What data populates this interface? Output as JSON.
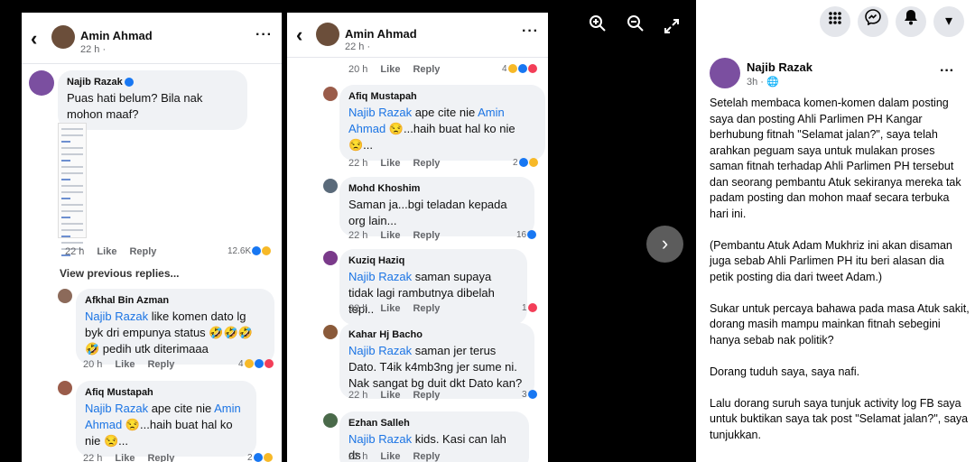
{
  "viewer": {
    "zoom_in_icon": "zoom-in-icon",
    "zoom_out_icon": "zoom-out-icon",
    "fullscreen_icon": "expand-icon",
    "next_icon": "chevron-right-icon"
  },
  "panel1": {
    "author": "Amin Ahmad",
    "time": "22 h ·",
    "main_comment": {
      "name": "Najib Razak",
      "text": "Puas hati belum? Bila nak mohon maaf?",
      "time": "22 h",
      "like": "Like",
      "reply": "Reply",
      "count": "12.6K"
    },
    "view_previous": "View previous replies...",
    "replies": [
      {
        "name": "Afkhal Bin Azman",
        "mention": "Najib Razak",
        "text": " like komen dato lg byk dri empunya status 🤣🤣🤣🤣 pedih utk diterimaaa",
        "time": "20 h",
        "count": "4"
      },
      {
        "name": "Afiq Mustapah",
        "mention": "Najib Razak",
        "text": " ape cite nie ",
        "mention2": "Amin Ahmad",
        "text2": " 😒...haih buat hal ko nie 😒...",
        "time": "22 h",
        "count": "2"
      }
    ]
  },
  "panel2": {
    "author": "Amin Ahmad",
    "time": "22 h ·",
    "top_meta": {
      "time": "20 h",
      "count": "4"
    },
    "comments": [
      {
        "name": "Afiq Mustapah",
        "mention": "Najib Razak",
        "text": " ape cite nie ",
        "mention2": "Amin Ahmad",
        "text2": " 😒...haih buat hal ko nie 😒...",
        "time": "22 h",
        "count": "2"
      },
      {
        "name": "Mohd Khoshim",
        "text": "Saman ja...bgi teladan kepada org lain...",
        "time": "22 h",
        "count": "16"
      },
      {
        "name": "Kuziq Haziq",
        "mention": "Najib Razak",
        "text": " saman supaya tidak lagi rambutnya dibelah tepi..",
        "time": "22 h",
        "count": "1"
      },
      {
        "name": "Kahar Hj Bacho",
        "mention": "Najib Razak",
        "text": " saman jer terus Dato. T4ik k4mb3ng jer sume ni. Nak sangat bg duit dkt Dato kan?",
        "time": "22 h",
        "count": "3"
      },
      {
        "name": "Ezhan Salleh",
        "mention": "Najib Razak",
        "text": " kids. Kasi can lah ds",
        "time": "22 h",
        "count": ""
      }
    ],
    "like": "Like",
    "reply": "Reply"
  },
  "sidebar": {
    "nav_icons": [
      "menu-grid-icon",
      "messenger-icon",
      "notifications-icon",
      "account-dropdown-icon"
    ],
    "post_author": "Najib Razak",
    "post_time": "3h · 🌐",
    "paragraphs": [
      "Setelah membaca komen-komen dalam posting saya dan posting Ahli Parlimen PH Kangar berhubung fitnah \"Selamat jalan?\", saya telah arahkan peguam saya untuk mulakan proses saman fitnah terhadap Ahli Parlimen PH tersebut dan seorang pembantu Atuk sekiranya mereka tak padam posting dan mohon maaf secara terbuka hari ini.",
      "(Pembantu Atuk Adam Mukhriz ini akan disaman juga sebab Ahli Parlimen PH itu beri alasan dia petik posting dia dari tweet Adam.)",
      "Sukar untuk percaya bahawa pada masa Atuk sakit, dorang masih mampu mainkan fitnah sebegini hanya sebab nak politik?",
      "Dorang tuduh saya, saya nafi.",
      "Lalu dorang suruh saya tunjuk activity log FB saya untuk buktikan saya tak post \"Selamat jalan?\", saya tunjukkan."
    ]
  },
  "colors": {
    "link": "#1b74e4",
    "bubble": "#f0f2f5",
    "meta": "#65676b"
  }
}
